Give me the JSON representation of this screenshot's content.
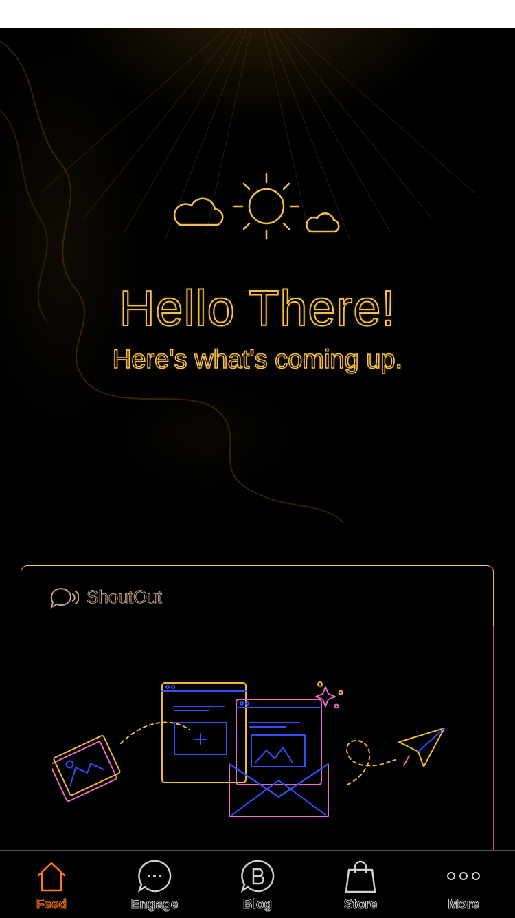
{
  "hero": {
    "title": "Hello There!",
    "subtitle": "Here's what's coming up.",
    "illustration": "sun-with-clouds"
  },
  "shoutout": {
    "label": "ShoutOut",
    "icon": "megaphone-chat-icon"
  },
  "post": {
    "illustration": "send-images-by-mail"
  },
  "tabs": [
    {
      "label": "Feed",
      "icon": "home-icon",
      "active": true
    },
    {
      "label": "Engage",
      "icon": "chat-bubble-icon",
      "active": false
    },
    {
      "label": "Blog",
      "icon": "blog-b-icon",
      "active": false
    },
    {
      "label": "Store",
      "icon": "shopping-bag-icon",
      "active": false
    },
    {
      "label": "More",
      "icon": "more-dots-icon",
      "active": false
    }
  ],
  "colors": {
    "accent": "#f6c14a",
    "active_tab": "#ff7a1a",
    "card_border": "#e8c35a",
    "post_border": "#e0437a",
    "background": "#000000"
  }
}
